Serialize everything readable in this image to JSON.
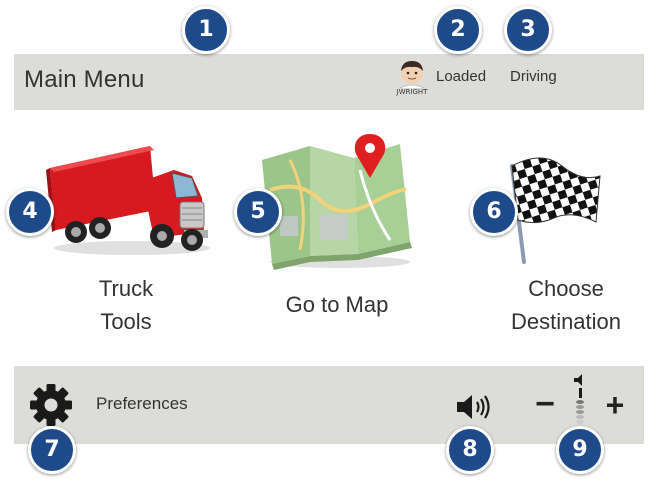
{
  "header": {
    "title": "Main Menu",
    "driver_name": "JWRIGHT",
    "load_status": "Loaded",
    "driving_status": "Driving"
  },
  "tiles": [
    {
      "label_line1": "Truck",
      "label_line2": "Tools",
      "icon": "truck-icon"
    },
    {
      "label_line1": "Go to Map",
      "icon": "map-icon"
    },
    {
      "label_line1": "Choose",
      "label_line2": "Destination",
      "icon": "checkered-flag-icon"
    }
  ],
  "footer": {
    "preferences_label": "Preferences",
    "preferences_icon": "gear-icon",
    "volume_icon": "speaker-icon",
    "volume_minus": "−",
    "volume_plus": "+"
  },
  "callouts": [
    "1",
    "2",
    "3",
    "4",
    "5",
    "6",
    "7",
    "8",
    "9"
  ],
  "colors": {
    "bar_background": "#dcdcd9",
    "badge_blue": "#1e4a8a",
    "truck_red": "#d71920",
    "map_pin_red": "#e02020"
  }
}
